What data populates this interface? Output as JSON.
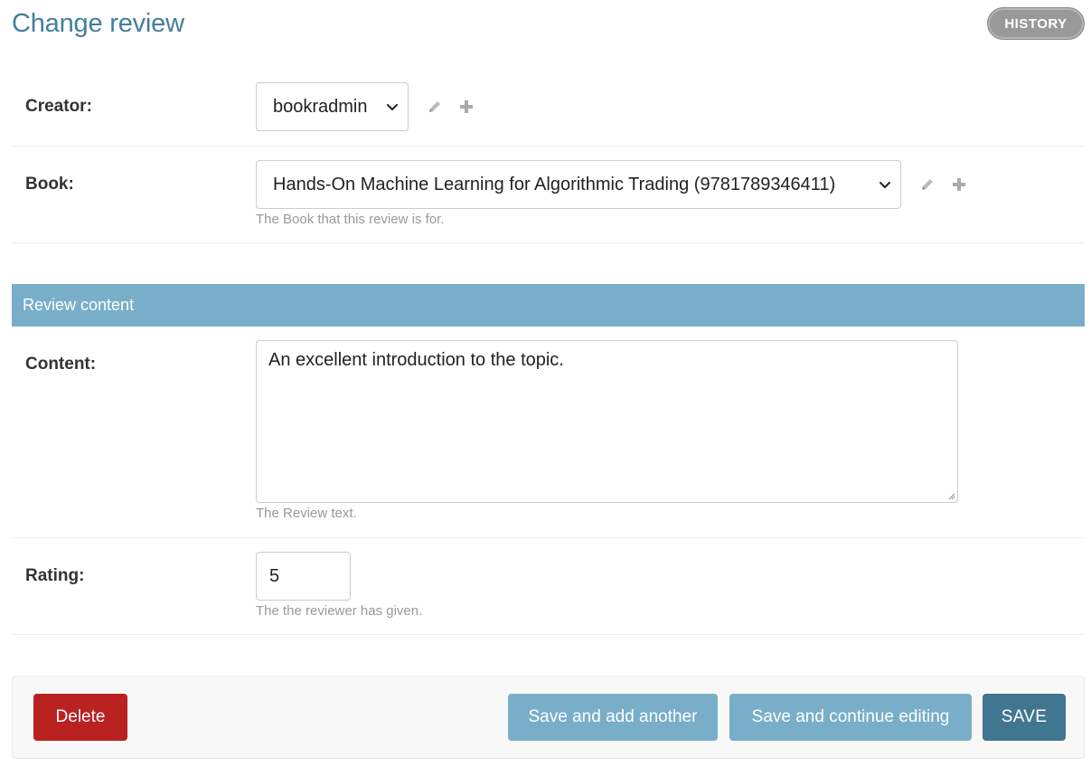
{
  "page": {
    "title": "Change review",
    "history_label": "HISTORY"
  },
  "fields": {
    "creator": {
      "label": "Creator:",
      "value": "bookradmin"
    },
    "book": {
      "label": "Book:",
      "value": "Hands-On Machine Learning for Algorithmic Trading (9781789346411)",
      "help": "The Book that this review is for."
    }
  },
  "fieldset": {
    "title": "Review content"
  },
  "content": {
    "label": "Content:",
    "value": "An excellent introduction to the topic.",
    "help": "The Review text."
  },
  "rating": {
    "label": "Rating:",
    "value": "5",
    "help": "The the reviewer has given."
  },
  "actions": {
    "delete_label": "Delete",
    "save_add_label": "Save and add another",
    "save_continue_label": "Save and continue editing",
    "save_label": "SAVE"
  },
  "colors": {
    "title": "#447e9b",
    "fieldset_header": "#79aec8",
    "delete": "#ba2121",
    "primary_save": "#417690"
  },
  "icons": [
    "pencil-icon",
    "plus-icon",
    "chevron-down-icon"
  ]
}
